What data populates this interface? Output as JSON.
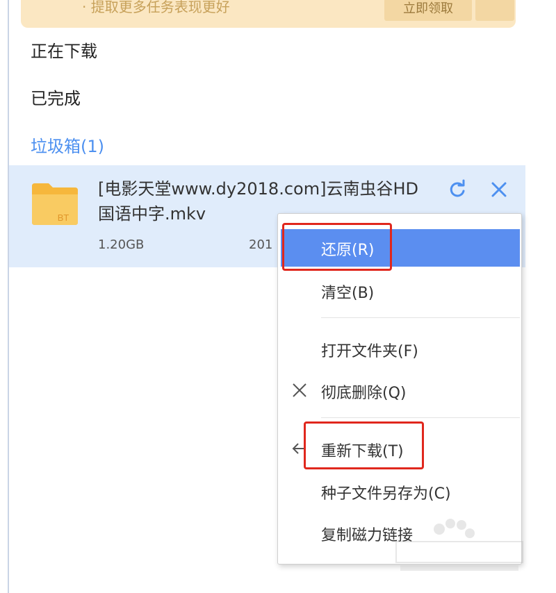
{
  "banner": {
    "text": "· 提取更多任务表现更好",
    "button": "立即领取"
  },
  "nav": {
    "downloading": "正在下载",
    "completed": "已完成",
    "trash": "垃圾箱(1)"
  },
  "file": {
    "name": "[电影天堂www.dy2018.com]云南虫谷HD国语中字.mkv",
    "type_badge": "BT",
    "size": "1.20GB",
    "date": "201"
  },
  "context_menu": {
    "items": [
      {
        "label": "还原(R)",
        "active": true
      },
      {
        "label": "清空(B)"
      },
      {
        "label": "打开文件夹(F)"
      },
      {
        "label": "彻底删除(Q)",
        "icon": "close-icon"
      },
      {
        "label": "重新下载(T)",
        "icon": "back-arrow-icon"
      },
      {
        "label": "种子文件另存为(C)"
      },
      {
        "label": "复制磁力链接"
      }
    ]
  },
  "colors": {
    "accent": "#4d90f0",
    "menu_active": "#5b8ef0",
    "highlight": "#e0271d",
    "row_selected": "#e0ecfb",
    "banner_bg": "#fbe7c2"
  }
}
